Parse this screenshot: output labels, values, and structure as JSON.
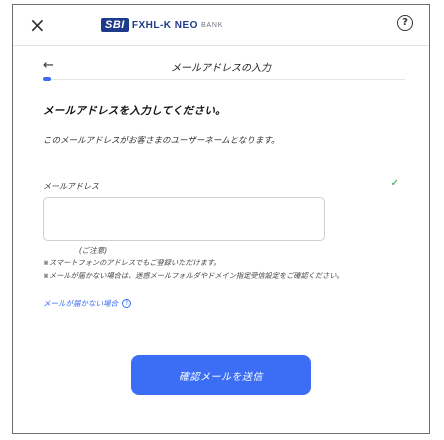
{
  "header": {
    "close_icon": "×",
    "brand_logo": "SBI",
    "brand_name": "FXHL-K NEO",
    "brand_sub": "BANK",
    "help_icon": "?"
  },
  "nav": {
    "back_icon": "←",
    "title": "メールアドレスの入力"
  },
  "progress": {
    "value": 0.02,
    "color": "#3b6ef5"
  },
  "heading": "メールアドレスを入力してください。",
  "description": "このメールアドレスがお客さまのユーザーネームとなります。",
  "email": {
    "label": "メールアドレス",
    "value": "",
    "placeholder": ""
  },
  "notes": {
    "title": "(ご注意)",
    "items": [
      "※スマートフォンのアドレスでもご登録いただけます。",
      "※メールが届かない場合は、迷惑メールフォルダやドメイン指定受信設定をご確認ください。"
    ]
  },
  "help_link": "メールが届かない場合",
  "submit": "確認メールを送信",
  "colors": {
    "accent": "#3b6ef5",
    "brand": "#1e3a8a",
    "check": "#2aa146"
  }
}
